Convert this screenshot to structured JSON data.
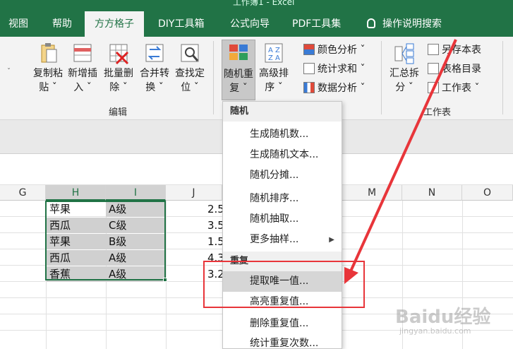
{
  "window": {
    "title": "工作簿1 - Excel"
  },
  "tabs": [
    {
      "label": "视图"
    },
    {
      "label": "帮助"
    },
    {
      "label": "方方格子"
    },
    {
      "label": "DIY工具箱"
    },
    {
      "label": "公式向导"
    },
    {
      "label": "PDF工具集"
    },
    {
      "label": "操作说明搜索"
    }
  ],
  "ribbon": {
    "buttons": [
      {
        "line1": "复制粘",
        "line2": "贴 ˇ"
      },
      {
        "line1": "新增插",
        "line2": "入 ˇ"
      },
      {
        "line1": "批量删",
        "line2": "除 ˇ"
      },
      {
        "line1": "合并转",
        "line2": "换 ˇ"
      },
      {
        "line1": "查找定",
        "line2": "位 ˇ"
      },
      {
        "line1": "随机重",
        "line2": "复 ˇ"
      },
      {
        "line1": "高级排",
        "line2": "序 ˇ"
      }
    ],
    "small_items": [
      {
        "label": "颜色分析 ˇ"
      },
      {
        "label": "统计求和 ˇ"
      },
      {
        "label": "数据分析 ˇ"
      }
    ],
    "summary_button": {
      "line1": "汇总拆",
      "line2": "分 ˇ"
    },
    "sheet_items": [
      {
        "label": "另存本表"
      },
      {
        "label": "表格目录"
      },
      {
        "label": "工作表 ˇ"
      }
    ],
    "group_labels": {
      "edit": "编辑",
      "sheet": "工作表"
    }
  },
  "grid": {
    "columns": [
      {
        "label": "G"
      },
      {
        "label": "H"
      },
      {
        "label": "I"
      },
      {
        "label": "J"
      },
      {
        "label": "M"
      },
      {
        "label": "N"
      },
      {
        "label": "O"
      }
    ],
    "rows": [
      {
        "h": "苹果",
        "i": "A级",
        "j": "2.5"
      },
      {
        "h": "西瓜",
        "i": "C级",
        "j": "3.5"
      },
      {
        "h": "苹果",
        "i": "B级",
        "j": "1.5"
      },
      {
        "h": "西瓜",
        "i": "A级",
        "j": "4.3"
      },
      {
        "h": "香蕉",
        "i": "A级",
        "j": "3.2"
      }
    ]
  },
  "menu": {
    "section1": "随机",
    "items1": [
      {
        "label": "生成随机数..."
      },
      {
        "label": "生成随机文本..."
      },
      {
        "label": "随机分摊..."
      },
      {
        "label": "随机排序..."
      },
      {
        "label": "随机抽取..."
      },
      {
        "label": "更多抽样..."
      }
    ],
    "section2": "重复",
    "items2": [
      {
        "label": "提取唯一值..."
      },
      {
        "label": "高亮重复值..."
      },
      {
        "label": "删除重复值..."
      },
      {
        "label": "统计重复次数..."
      }
    ]
  },
  "colors": {
    "excel_green": "#217346",
    "annotation_red": "#e8353a"
  },
  "watermark": {
    "text": "Baidu经验",
    "sub": "jingyan.baidu.com"
  }
}
